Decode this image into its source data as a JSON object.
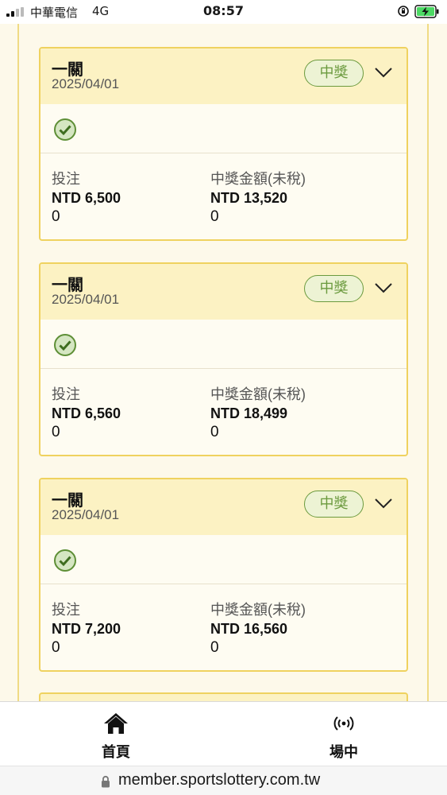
{
  "status_bar": {
    "carrier": "中華電信",
    "network": "4G",
    "time": "08:57"
  },
  "bets": [
    {
      "title": "一關",
      "date": "2025/04/01",
      "result_badge": "中獎",
      "stake_label": "投注",
      "stake_amount": "NTD 6,500",
      "stake_extra": "0",
      "winnings_label": "中獎金額(未稅)",
      "winnings_amount": "NTD 13,520",
      "winnings_extra": "0"
    },
    {
      "title": "一關",
      "date": "2025/04/01",
      "result_badge": "中獎",
      "stake_label": "投注",
      "stake_amount": "NTD 6,560",
      "stake_extra": "0",
      "winnings_label": "中獎金額(未稅)",
      "winnings_amount": "NTD 18,499",
      "winnings_extra": "0"
    },
    {
      "title": "一關",
      "date": "2025/04/01",
      "result_badge": "中獎",
      "stake_label": "投注",
      "stake_amount": "NTD 7,200",
      "stake_extra": "0",
      "winnings_label": "中獎金額(未稅)",
      "winnings_amount": "NTD 16,560",
      "winnings_extra": "0"
    }
  ],
  "tabbar": {
    "home_label": "首頁",
    "live_label": "場中"
  },
  "browser": {
    "url": "member.sportslottery.com.tw"
  },
  "colors": {
    "card_border": "#efd25f",
    "card_header": "#fcf2c3",
    "win_green": "#6b9a3e"
  }
}
